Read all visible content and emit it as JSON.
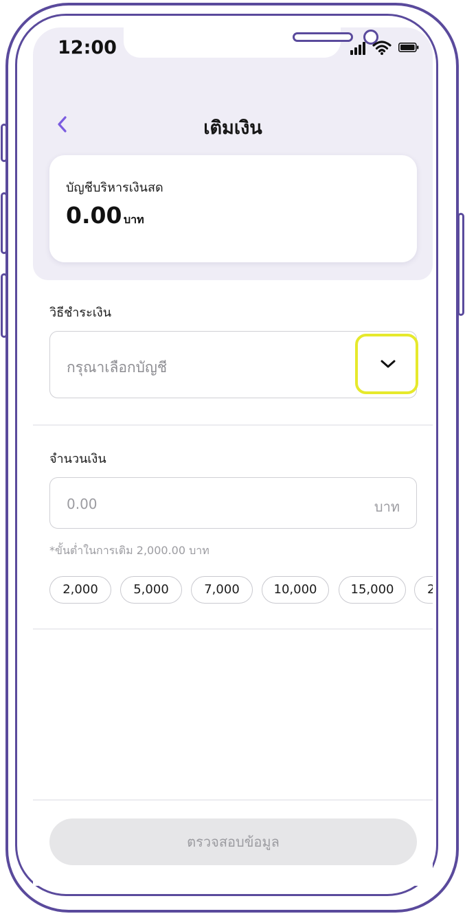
{
  "status_bar": {
    "time": "12:00"
  },
  "header": {
    "title": "เติมเงิน"
  },
  "balance": {
    "label": "บัญชีบริหารเงินสด",
    "amount": "0.00",
    "unit": "บาท"
  },
  "payment": {
    "label": "วิธีชำระเงิน",
    "placeholder": "กรุณาเลือกบัญชี"
  },
  "amount": {
    "label": "จำนวนเงิน",
    "value": "0.00",
    "unit": "บาท",
    "min_note": "*ขั้นต่ำในการเติม 2,000.00 บาท"
  },
  "chips": [
    "2,000",
    "5,000",
    "7,000",
    "10,000",
    "15,000",
    "2"
  ],
  "footer": {
    "button_label": "ตรวจสอบข้อมูล"
  },
  "colors": {
    "accent": "#7b5ce0",
    "frame": "#5a4a9c",
    "highlight": "#e6e92c",
    "header_bg": "#efedf6"
  }
}
